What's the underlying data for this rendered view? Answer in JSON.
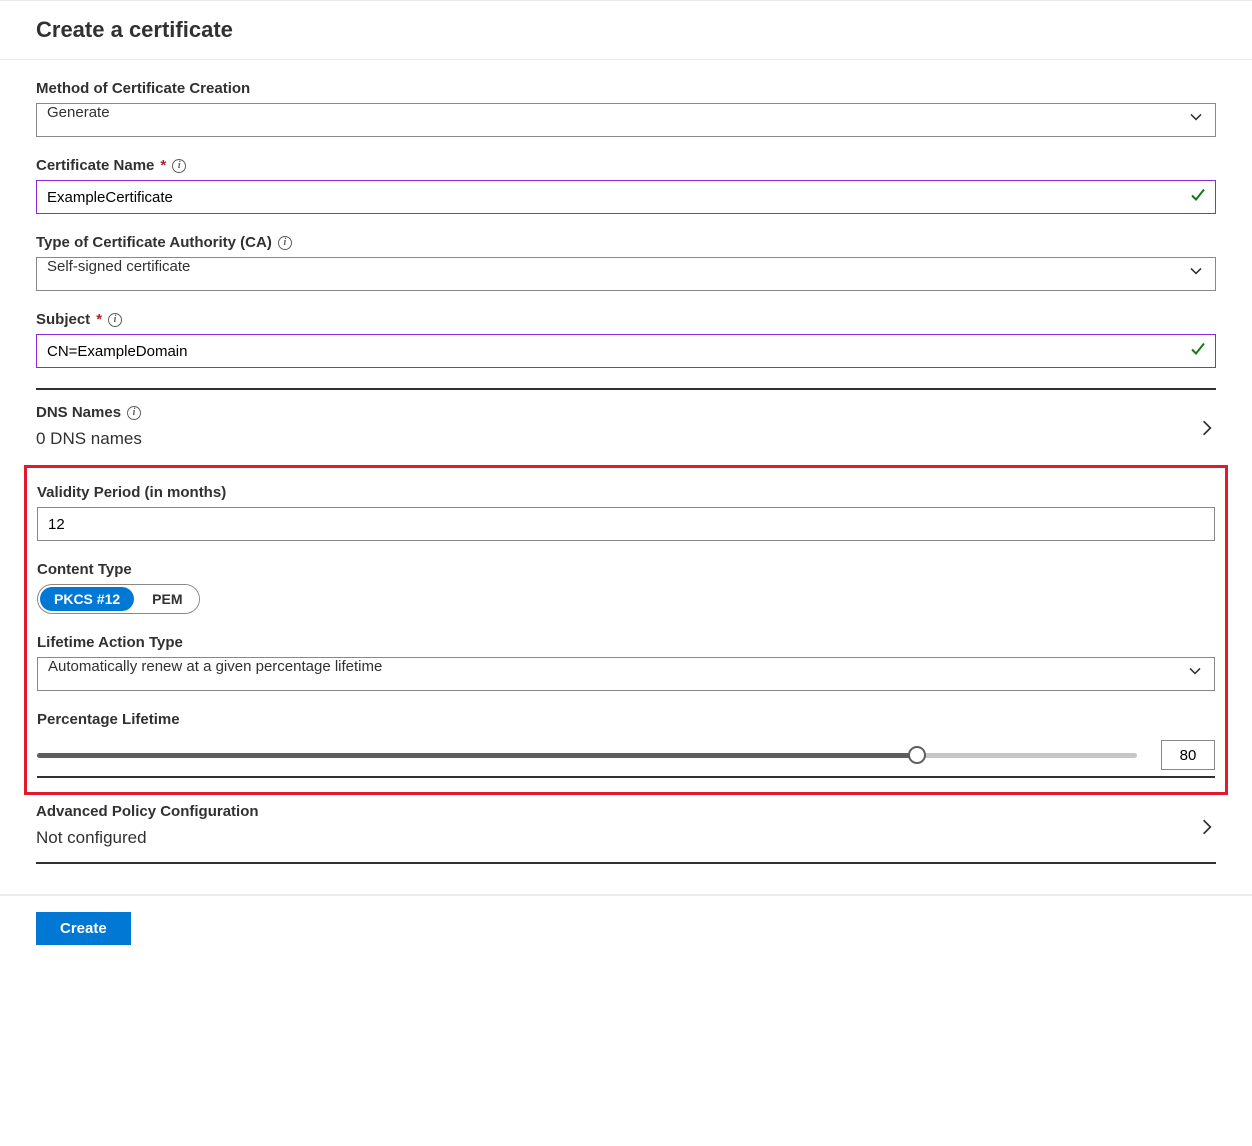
{
  "title": "Create a certificate",
  "fields": {
    "method": {
      "label": "Method of Certificate Creation",
      "value": "Generate"
    },
    "name": {
      "label": "Certificate Name",
      "value": "ExampleCertificate"
    },
    "ca": {
      "label": "Type of Certificate Authority (CA)",
      "value": "Self-signed certificate"
    },
    "subject": {
      "label": "Subject",
      "value": "CN=ExampleDomain"
    },
    "dns": {
      "label": "DNS Names",
      "value": "0 DNS names"
    },
    "validity": {
      "label": "Validity Period (in months)",
      "value": "12"
    },
    "contentType": {
      "label": "Content Type",
      "options": [
        "PKCS #12",
        "PEM"
      ],
      "selected": "PKCS #12"
    },
    "lifetimeAction": {
      "label": "Lifetime Action Type",
      "value": "Automatically renew at a given percentage lifetime"
    },
    "percentage": {
      "label": "Percentage Lifetime",
      "value": "80"
    },
    "advanced": {
      "label": "Advanced Policy Configuration",
      "value": "Not configured"
    }
  },
  "buttons": {
    "create": "Create"
  }
}
